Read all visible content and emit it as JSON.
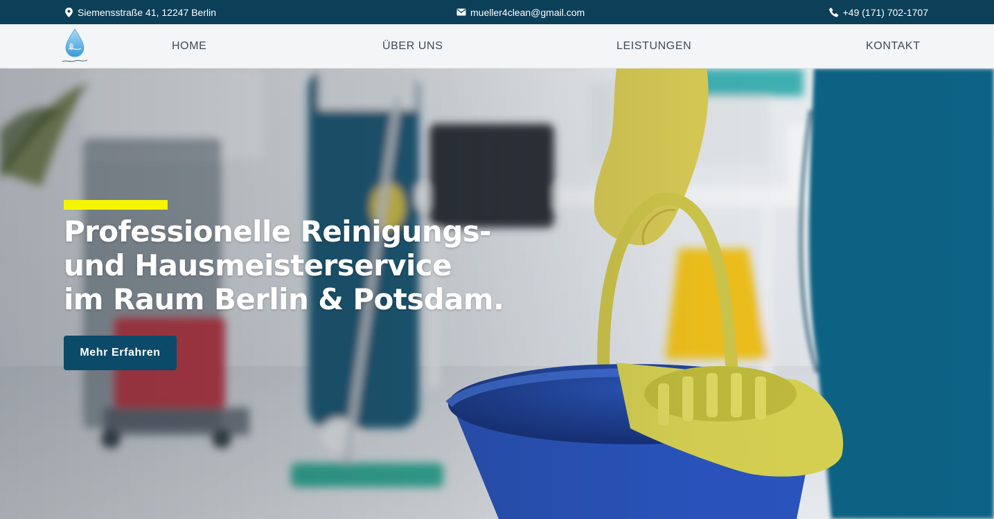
{
  "topbar": {
    "address": "Siemensstraße 41, 12247 Berlin",
    "address_icon": "location-pin-icon",
    "email": "mueller4clean@gmail.com",
    "email_icon": "envelope-icon",
    "phone": "+49 (171) 702-1707",
    "phone_icon": "phone-icon"
  },
  "nav": {
    "logo_icon": "water-drop-logo",
    "items": [
      {
        "label": "HOME"
      },
      {
        "label": "ÜBER UNS"
      },
      {
        "label": "LEISTUNGEN"
      },
      {
        "label": "KONTAKT"
      }
    ]
  },
  "hero": {
    "headline_lines": [
      "Professionelle Reinigungs-",
      "und Hausmeisterservice",
      "im Raum Berlin & Potsdam."
    ],
    "cta_label": "Mehr Erfahren"
  },
  "colors": {
    "topbar_bg": "#0c3f58",
    "accent_yellow": "#f5f500",
    "cta_bg": "#0c4a6a",
    "nav_bg": "#f3f5f7",
    "nav_text": "#3e4a55"
  }
}
